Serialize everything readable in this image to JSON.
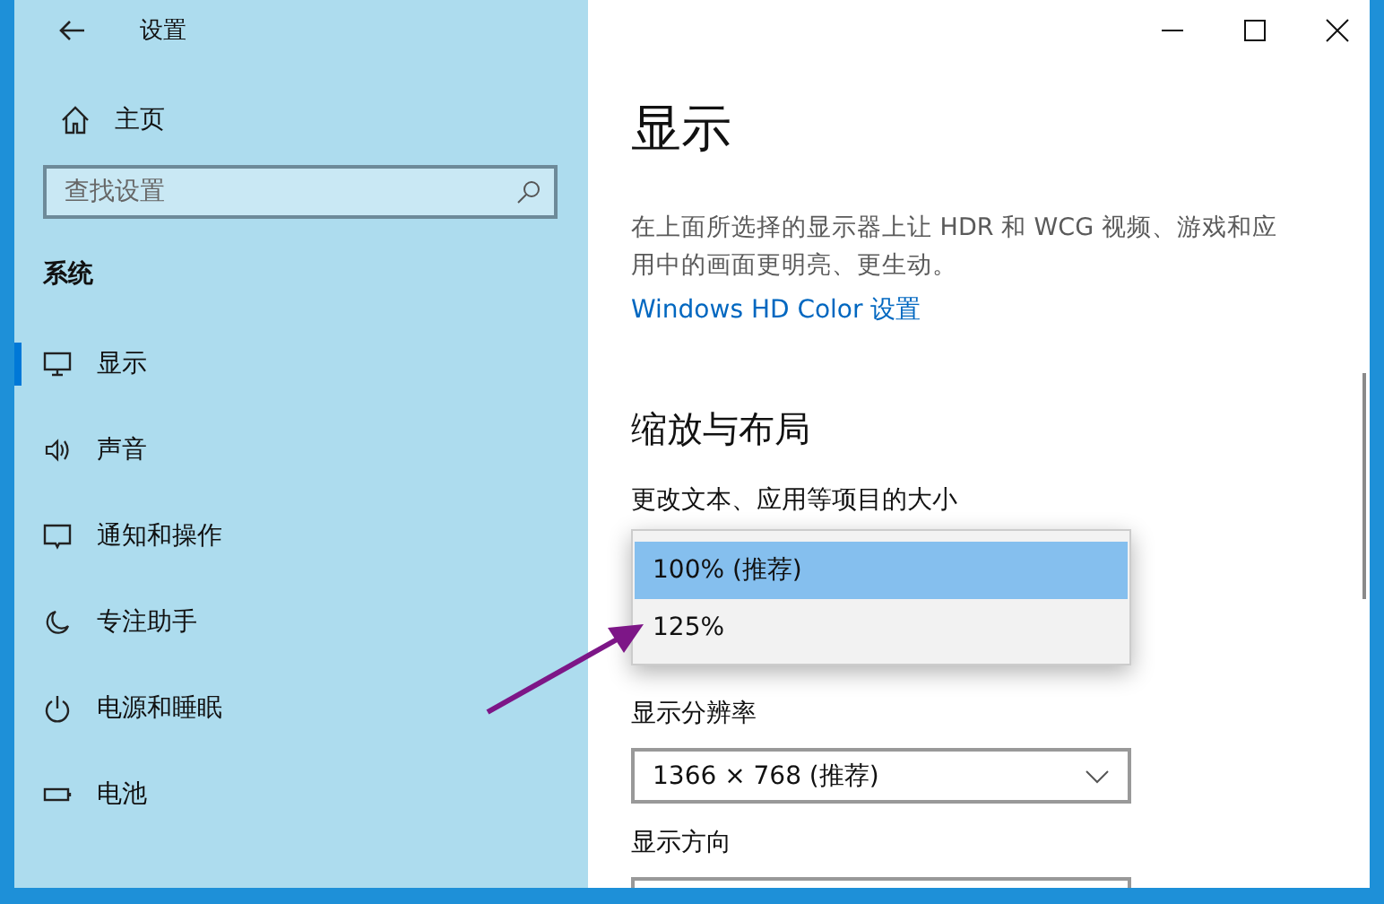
{
  "window": {
    "title": "设置"
  },
  "sidebar": {
    "home": "主页",
    "search": {
      "placeholder": "查找设置"
    },
    "section": "系统",
    "items": [
      {
        "label": "显示",
        "selected": true
      },
      {
        "label": "声音",
        "selected": false
      },
      {
        "label": "通知和操作",
        "selected": false
      },
      {
        "label": "专注助手",
        "selected": false
      },
      {
        "label": "电源和睡眠",
        "selected": false
      },
      {
        "label": "电池",
        "selected": false
      }
    ]
  },
  "content": {
    "heading": "显示",
    "description": "在上面所选择的显示器上让 HDR 和 WCG 视频、游戏和应用中的画面更明亮、更生动。",
    "link": "Windows HD Color 设置",
    "section_title": "缩放与布局",
    "scale_label": "更改文本、应用等项目的大小",
    "scale_options": [
      {
        "label": "100% (推荐)",
        "selected": true
      },
      {
        "label": "125%",
        "selected": false
      }
    ],
    "resolution_label": "显示分辨率",
    "resolution": {
      "value": "1366 × 768 (推荐)"
    },
    "orientation_label": "显示方向"
  }
}
